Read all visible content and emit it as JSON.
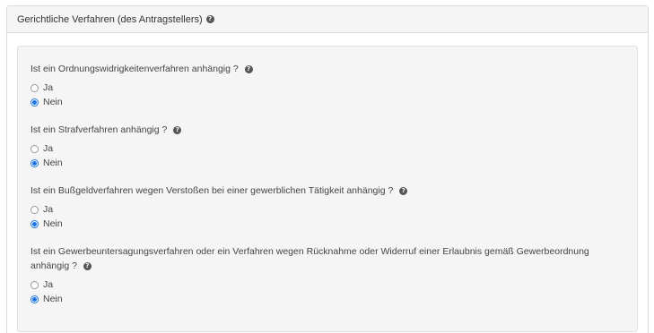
{
  "panel": {
    "title": "Gerichtliche Verfahren (des Antragstellers)",
    "help_glyph": "?"
  },
  "questions": [
    {
      "text": "Ist ein Ordnungswidrigkeitenverfahren anhängig ?",
      "options": [
        {
          "label": "Ja",
          "checked": false
        },
        {
          "label": "Nein",
          "checked": true
        }
      ]
    },
    {
      "text": "Ist ein Strafverfahren anhängig ?",
      "options": [
        {
          "label": "Ja",
          "checked": false
        },
        {
          "label": "Nein",
          "checked": true
        }
      ]
    },
    {
      "text": "Ist ein Bußgeldverfahren wegen Verstoßen bei einer gewerblichen Tätigkeit anhängig ?",
      "options": [
        {
          "label": "Ja",
          "checked": false
        },
        {
          "label": "Nein",
          "checked": true
        }
      ]
    },
    {
      "text_line1": "Ist ein Gewerbeuntersagungsverfahren oder ein Verfahren wegen Rücknahme oder Widerruf einer Erlaubnis gemäß Gewerbeordnung",
      "text_line2": "anhängig ?",
      "options": [
        {
          "label": "Ja",
          "checked": false
        },
        {
          "label": "Nein",
          "checked": true
        }
      ]
    }
  ],
  "colors": {
    "accent": "#1a73e8",
    "heading_bg": "#f5f5f5",
    "well_bg": "#f5f5f5"
  },
  "icons": {
    "help": "question-circle-icon"
  }
}
